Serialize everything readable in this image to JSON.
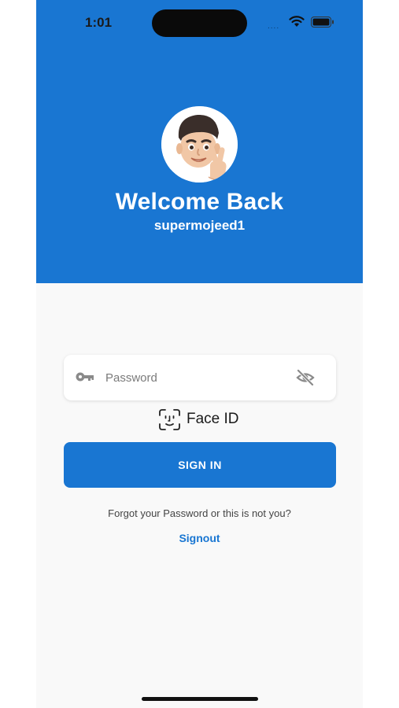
{
  "status_bar": {
    "time": "1:01",
    "signal": "....",
    "icons": [
      "wifi-icon",
      "battery-icon"
    ]
  },
  "header": {
    "background_color": "#1976d2",
    "avatar_icon": "memoji-avatar",
    "title": "Welcome Back",
    "username": "supermojeed1"
  },
  "form": {
    "password_placeholder": "Password",
    "password_value": "",
    "key_icon": "key-icon",
    "visibility_icon": "eye-off-icon",
    "face_id_label": "Face ID",
    "face_id_icon": "face-id-icon",
    "signin_label": "SIGN IN",
    "forgot_text": "Forgot your Password or this is not you?",
    "signout_label": "Signout"
  },
  "colors": {
    "accent": "#1976d2",
    "background": "#f9f9f9"
  }
}
